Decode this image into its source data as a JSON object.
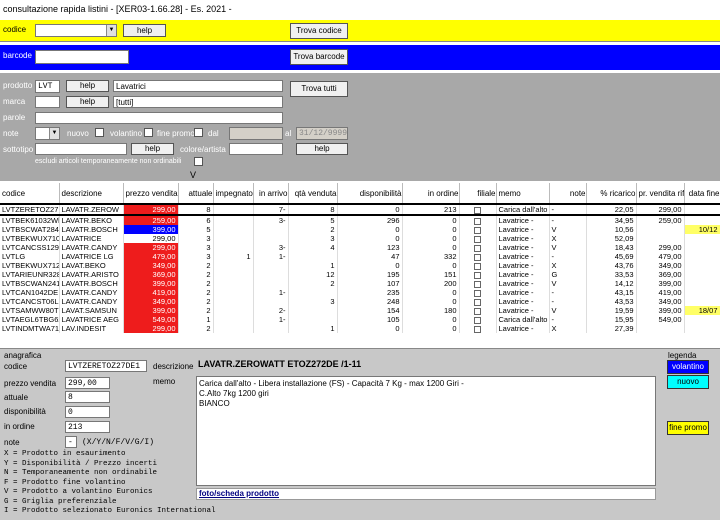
{
  "window_title": "consultazione rapida listini - [XER03-1.66.28] - Es. 2021 -",
  "codice_bar": {
    "label": "codice",
    "help": "help",
    "trova": "Trova codice"
  },
  "barcode_bar": {
    "label": "barcode",
    "trova": "Trova barcode"
  },
  "filters": {
    "prodotto_label": "prodotto",
    "prodotto_value": "LVT",
    "prodotto_help": "help",
    "prodotto_desc": "Lavatrici",
    "marca_label": "marca",
    "marca_help": "help",
    "marca_desc": "[tutti]",
    "parole_label": "parole",
    "note_label": "note",
    "nuovo_label": "nuovo",
    "volantino_label": "volantino",
    "fine_promo_label": "fine promo",
    "dal_label": "dal",
    "al_label": "al",
    "al_value": "31/12/9999",
    "sottotipo_label": "sottotipo",
    "sottotipo_help": "help",
    "colore_label": "colore/artista",
    "colore_help": "help",
    "escludi_label": "escludi articoli temporaneamente non ordinabili",
    "trova_tutti": "Trova tutti"
  },
  "sort_indicator": "V",
  "table": {
    "columns": [
      "codice",
      "descrizione",
      "prezzo vendita",
      "attuale",
      "impegnato",
      "in arrivo",
      "qtà venduta",
      "disponibilità",
      "in ordine",
      "filiale",
      "memo",
      "note",
      "% ricarico",
      "pr. vendita rif.",
      "data fine"
    ],
    "rows": [
      {
        "codice": "LVTZERETOZ27",
        "descrizione": "LAVATR.ZEROW",
        "prezzo": "299,00",
        "pc": "red",
        "attuale": "8",
        "impegnato": "",
        "arrivo": "7-",
        "venduta": "8",
        "disp": "0",
        "ordine": "213",
        "memo": "Carica dall'alto -",
        "note": "-",
        "ricarico": "22,05",
        "rif": "299,00",
        "fine": "",
        "fc": ""
      },
      {
        "codice": "LVTBEK61032Wl",
        "descrizione": "LAVATR.BEKO",
        "prezzo": "259,00",
        "pc": "red",
        "attuale": "6",
        "impegnato": "",
        "arrivo": "3-",
        "venduta": "5",
        "disp": "296",
        "ordine": "0",
        "memo": "Lavatrice -",
        "note": "-",
        "ricarico": "34,95",
        "rif": "259,00",
        "fine": "",
        "fc": ""
      },
      {
        "codice": "LVTBSCWAT284",
        "descrizione": "LAVATR.BOSCH",
        "prezzo": "399,00",
        "pc": "blu",
        "attuale": "5",
        "impegnato": "",
        "arrivo": "",
        "venduta": "2",
        "disp": "0",
        "ordine": "0",
        "memo": "Lavatrice -",
        "note": "V",
        "ricarico": "10,56",
        "rif": "",
        "fine": "10/12",
        "fc": "yel"
      },
      {
        "codice": "LVTBEKWUX710",
        "descrizione": "LAVATRICE",
        "prezzo": "299,00",
        "pc": "",
        "attuale": "3",
        "impegnato": "",
        "arrivo": "",
        "venduta": "3",
        "disp": "0",
        "ordine": "0",
        "memo": "Lavatrice -",
        "note": "X",
        "ricarico": "52,09",
        "rif": "",
        "fine": "",
        "fc": ""
      },
      {
        "codice": "LVTCANCSS129T",
        "descrizione": "LAVATR.CANDY",
        "prezzo": "299,00",
        "pc": "red",
        "attuale": "3",
        "impegnato": "",
        "arrivo": "3-",
        "venduta": "4",
        "disp": "123",
        "ordine": "0",
        "memo": "Lavatrice -",
        "note": "V",
        "ricarico": "18,43",
        "rif": "299,00",
        "fine": "",
        "fc": ""
      },
      {
        "codice": "LVTLG",
        "descrizione": "LAVATRICE LG",
        "prezzo": "479,00",
        "pc": "red",
        "attuale": "3",
        "impegnato": "1",
        "arrivo": "1-",
        "venduta": "",
        "disp": "47",
        "ordine": "332",
        "memo": "Lavatrice -",
        "note": "-",
        "ricarico": "45,69",
        "rif": "479,00",
        "fine": "",
        "fc": ""
      },
      {
        "codice": "LVTBEKWUX712",
        "descrizione": "LAVAT.BEKO",
        "prezzo": "349,00",
        "pc": "red",
        "attuale": "2",
        "impegnato": "",
        "arrivo": "",
        "venduta": "1",
        "disp": "0",
        "ordine": "0",
        "memo": "Lavatrice -",
        "note": "X",
        "ricarico": "43,76",
        "rif": "349,00",
        "fine": "",
        "fc": ""
      },
      {
        "codice": "LVTARIEUNR328",
        "descrizione": "LAVATR.ARISTO",
        "prezzo": "369,00",
        "pc": "red",
        "attuale": "2",
        "impegnato": "",
        "arrivo": "",
        "venduta": "12",
        "disp": "195",
        "ordine": "151",
        "memo": "Lavatrice -",
        "note": "G",
        "ricarico": "33,53",
        "rif": "369,00",
        "fine": "",
        "fc": ""
      },
      {
        "codice": "LVTBSCWAN241",
        "descrizione": "LAVATR.BOSCH",
        "prezzo": "399,00",
        "pc": "red",
        "attuale": "2",
        "impegnato": "",
        "arrivo": "",
        "venduta": "2",
        "disp": "107",
        "ordine": "200",
        "memo": "Lavatrice -",
        "note": "V",
        "ricarico": "14,12",
        "rif": "399,00",
        "fine": "",
        "fc": ""
      },
      {
        "codice": "LVTCAN1042DE",
        "descrizione": "LAVATR.CANDY",
        "prezzo": "419,00",
        "pc": "red",
        "attuale": "2",
        "impegnato": "",
        "arrivo": "1-",
        "venduta": "",
        "disp": "235",
        "ordine": "0",
        "memo": "Lavatrice -",
        "note": "-",
        "ricarico": "43,15",
        "rif": "419,00",
        "fine": "",
        "fc": ""
      },
      {
        "codice": "LVTCANCST06LE",
        "descrizione": "LAVATR.CANDY",
        "prezzo": "349,00",
        "pc": "red",
        "attuale": "2",
        "impegnato": "",
        "arrivo": "",
        "venduta": "3",
        "disp": "248",
        "ordine": "0",
        "memo": "Lavatrice -",
        "note": "-",
        "ricarico": "43,53",
        "rif": "349,00",
        "fine": "",
        "fc": ""
      },
      {
        "codice": "LVTSAMWW80T",
        "descrizione": "LAVAT.SAMSUN",
        "prezzo": "399,00",
        "pc": "red",
        "attuale": "2",
        "impegnato": "",
        "arrivo": "2-",
        "venduta": "",
        "disp": "154",
        "ordine": "180",
        "memo": "Lavatrice -",
        "note": "V",
        "ricarico": "19,59",
        "rif": "399,00",
        "fine": "18/07",
        "fc": "yel"
      },
      {
        "codice": "LVTAEGL6TBG62",
        "descrizione": "LAVATRICE AEG",
        "prezzo": "549,00",
        "pc": "red",
        "attuale": "1",
        "impegnato": "",
        "arrivo": "1-",
        "venduta": "",
        "disp": "105",
        "ordine": "0",
        "memo": "Carica dall'alto -",
        "note": "-",
        "ricarico": "15,95",
        "rif": "549,00",
        "fine": "",
        "fc": ""
      },
      {
        "codice": "LVTINDMTWA71",
        "descrizione": "LAV.INDESIT",
        "prezzo": "299,00",
        "pc": "red",
        "attuale": "2",
        "impegnato": "",
        "arrivo": "",
        "venduta": "1",
        "disp": "0",
        "ordine": "0",
        "memo": "Lavatrice -",
        "note": "X",
        "ricarico": "27,39",
        "rif": "",
        "fine": "",
        "fc": ""
      }
    ]
  },
  "detail": {
    "anagrafica_label": "anagrafica",
    "codice_label": "codice",
    "codice_value": "LVTZERETOZ27DE1",
    "descrizione_label": "descrizione",
    "descrizione_value": "LAVATR.ZEROWATT ETOZ272DE /1-11",
    "prezzo_label": "prezzo vendita",
    "prezzo_value": "299,00",
    "memo_label": "memo",
    "memo_lines": [
      "Carica dall'alto - Libera installazione (FS) - Capacità 7 Kg - max 1200 Giri -",
      "C.Alto 7kg 1200 giri",
      "BIANCO"
    ],
    "attuale_label": "attuale",
    "attuale_value": "8",
    "disp_label": "disponibilità",
    "disp_value": "0",
    "ordine_label": "in ordine",
    "ordine_value": "213",
    "note_label": "note",
    "note_value": "-",
    "note_hint": "(X/Y/N/F/V/G/I)",
    "note_legend": [
      "X = Prodotto in esaurimento",
      "Y = Disponibilità / Prezzo incerti",
      "N = Temporaneamente non ordinabile",
      "F = Prodotto fine volantino",
      "V = Prodotto a volantino Euronics",
      "G = Griglia preferenziale",
      "I = Prodotto selezionato Euronics International"
    ],
    "link_text": "foto/scheda prodotto"
  },
  "legend": {
    "title": "legenda",
    "volantino": "volantino",
    "nuovo": "nuovo",
    "fine_promo": "fine promo"
  },
  "colors": {
    "red": "#ee1c1c",
    "blue": "#0000ff",
    "yellow": "#ffff00",
    "cyan": "#00ffff"
  }
}
